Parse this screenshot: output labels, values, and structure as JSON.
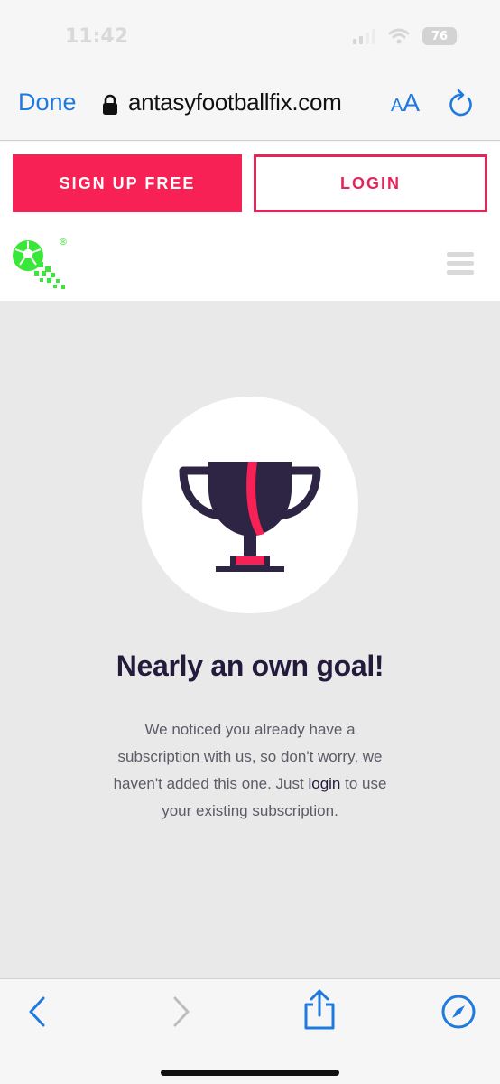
{
  "status_bar": {
    "time": "11:42",
    "battery": "76"
  },
  "browser": {
    "done_label": "Done",
    "url": "antasyfootballfix.com",
    "text_size_small": "A",
    "text_size_big": "A"
  },
  "site_header": {
    "signup_label": "SIGN UP FREE",
    "login_label": "LOGIN",
    "logo_mark": "®"
  },
  "main": {
    "headline": "Nearly an own goal!",
    "message_line1": "We noticed you already have a",
    "message_line2": "subscription with us, so don't worry, we",
    "message_line3_pre": "haven't added this one. Just ",
    "message_link": "login",
    "message_line3_post": " to use",
    "message_line4": "your existing subscription."
  },
  "colors": {
    "brand_pink": "#f72155",
    "navy": "#241a3b",
    "safari_blue": "#1f7ae0",
    "logo_green": "#39e639"
  },
  "icons": [
    "lock-icon",
    "reload-icon",
    "hamburger-icon",
    "trophy-icon",
    "back-icon",
    "forward-icon",
    "share-icon",
    "compass-icon"
  ]
}
